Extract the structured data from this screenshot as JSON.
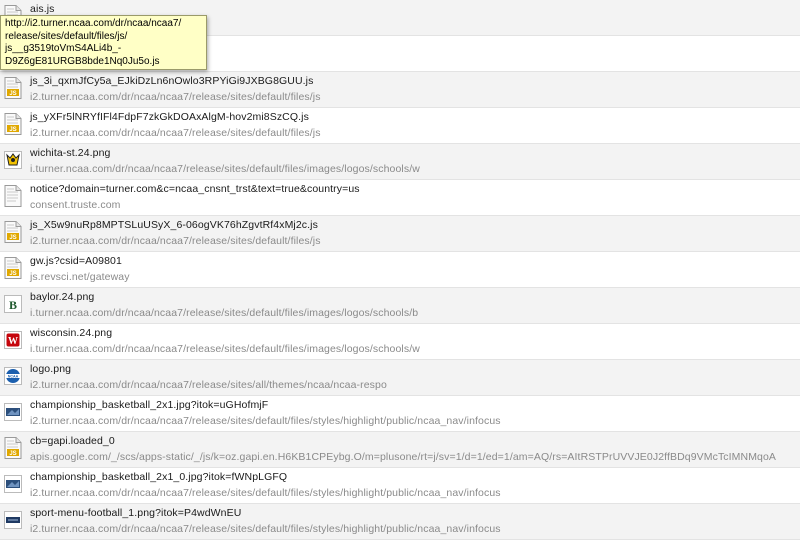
{
  "requests": [
    {
      "name": "ais.js",
      "url": "",
      "icon": "js-file-icon"
    },
    {
      "name": "",
      "url": "",
      "icon": "js-file-icon"
    },
    {
      "name": "js_3i_qxmJfCy5a_EJkiDzLn6nOwlo3RPYiGi9JXBG8GUU.js",
      "url": "i2.turner.ncaa.com/dr/ncaa/ncaa7/release/sites/default/files/js",
      "icon": "js-file-icon"
    },
    {
      "name": "js_yXFr5lNRYfIFl4FdpF7zkGkDOAxAlgM-hov2mi8SzCQ.js",
      "url": "i2.turner.ncaa.com/dr/ncaa/ncaa7/release/sites/default/files/js",
      "icon": "js-file-icon"
    },
    {
      "name": "wichita-st.24.png",
      "url": "i.turner.ncaa.com/dr/ncaa/ncaa7/release/sites/default/files/images/logos/schools/w",
      "icon": "wichita-state-logo-icon"
    },
    {
      "name": "notice?domain=turner.com&c=ncaa_cnsnt_trst&text=true&country=us",
      "url": "consent.truste.com",
      "icon": "document-file-icon"
    },
    {
      "name": "js_X5w9nuRp8MPTSLuUSyX_6-06ogVK76hZgvtRf4xMj2c.js",
      "url": "i2.turner.ncaa.com/dr/ncaa/ncaa7/release/sites/default/files/js",
      "icon": "js-file-icon"
    },
    {
      "name": "gw.js?csid=A09801",
      "url": "js.revsci.net/gateway",
      "icon": "js-file-icon"
    },
    {
      "name": "baylor.24.png",
      "url": "i.turner.ncaa.com/dr/ncaa/ncaa7/release/sites/default/files/images/logos/schools/b",
      "icon": "baylor-logo-icon"
    },
    {
      "name": "wisconsin.24.png",
      "url": "i.turner.ncaa.com/dr/ncaa/ncaa7/release/sites/default/files/images/logos/schools/w",
      "icon": "wisconsin-logo-icon"
    },
    {
      "name": "logo.png",
      "url": "i2.turner.ncaa.com/dr/ncaa/ncaa7/release/sites/all/themes/ncaa/ncaa-respo",
      "icon": "ncaa-logo-icon"
    },
    {
      "name": "championship_basketball_2x1.jpg?itok=uGHofmjF",
      "url": "i2.turner.ncaa.com/dr/ncaa/ncaa7/release/sites/default/files/styles/highlight/public/ncaa_nav/infocus",
      "icon": "image-thumbnail-icon"
    },
    {
      "name": "cb=gapi.loaded_0",
      "url": "apis.google.com/_/scs/apps-static/_/js/k=oz.gapi.en.H6KB1CPEybg.O/m=plusone/rt=j/sv=1/d=1/ed=1/am=AQ/rs=AItRSTPrUVVJE0J2ffBDq9VMcTcIMNMqoA",
      "icon": "js-file-icon"
    },
    {
      "name": "championship_basketball_2x1_0.jpg?itok=fWNpLGFQ",
      "url": "i2.turner.ncaa.com/dr/ncaa/ncaa7/release/sites/default/files/styles/highlight/public/ncaa_nav/infocus",
      "icon": "image-thumbnail-icon"
    },
    {
      "name": "sport-menu-football_1.png?itok=P4wdWnEU",
      "url": "i2.turner.ncaa.com/dr/ncaa/ncaa7/release/sites/default/files/styles/highlight/public/ncaa_nav/infocus",
      "icon": "football-thumbnail-icon"
    }
  ],
  "tooltip": {
    "lines": [
      "http://i2.turner.ncaa.com/dr/ncaa/ncaa7/",
      "release/sites/default/files/js/",
      "js__g3519toVmS4ALi4b_-",
      "D9Z6gE81URGB8bde1Nq0Ju5o.js"
    ]
  },
  "colors": {
    "row_alt": "#f3f3f3",
    "tooltip_bg": "#ffffc6",
    "js_badge": "#e0a800"
  }
}
